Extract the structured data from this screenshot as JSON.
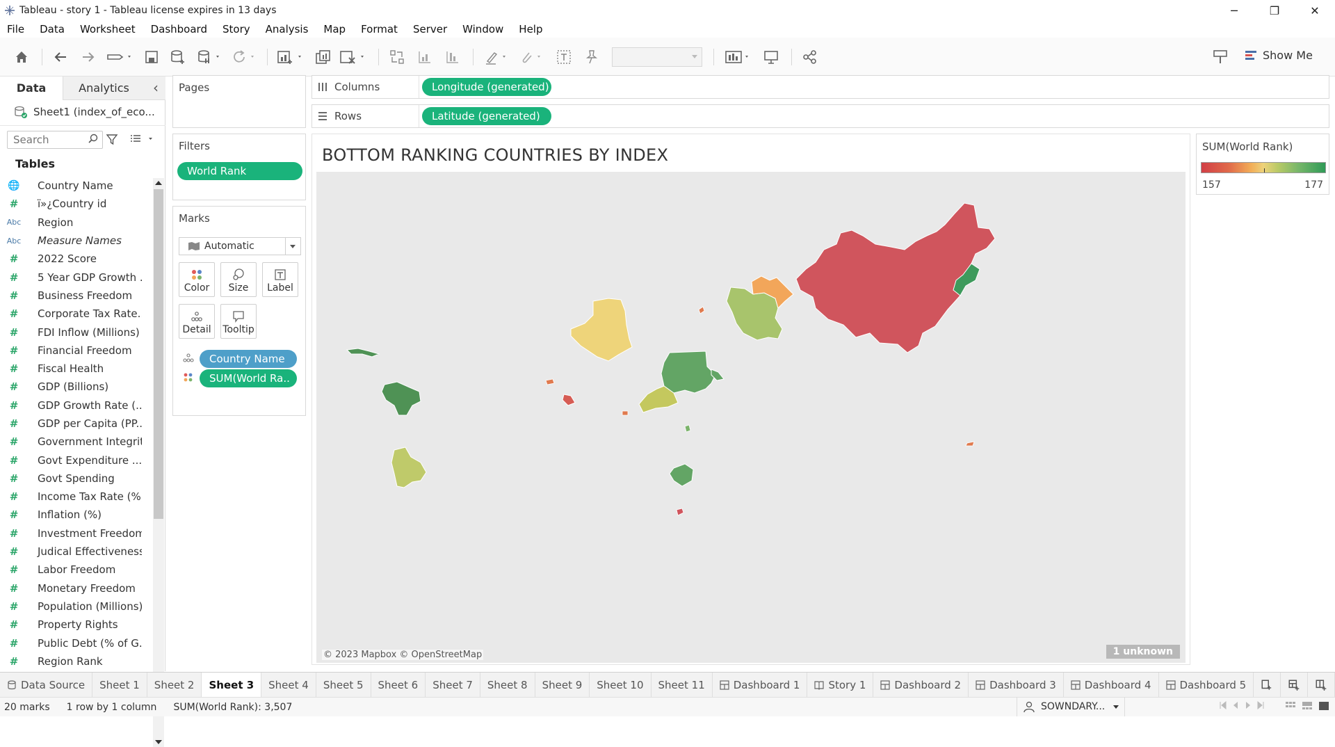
{
  "window": {
    "title": "Tableau - story 1 - Tableau license expires in 13 days",
    "minimize": "─",
    "restore": "❐",
    "close": "✕"
  },
  "menu": [
    "File",
    "Data",
    "Worksheet",
    "Dashboard",
    "Story",
    "Analysis",
    "Map",
    "Format",
    "Server",
    "Window",
    "Help"
  ],
  "toolbar": {
    "show_me": "Show Me"
  },
  "left_panel": {
    "tab_data": "Data",
    "tab_analytics": "Analytics",
    "collapse": "‹",
    "data_source": "Sheet1 (index_of_eco...",
    "search_placeholder": "Search",
    "tables_heading": "Tables",
    "fields": [
      {
        "type": "geo",
        "name": "Country Name",
        "italic": false
      },
      {
        "type": "num",
        "name": "ï»¿Country id",
        "italic": false
      },
      {
        "type": "abc",
        "name": "Region",
        "italic": false
      },
      {
        "type": "abc",
        "name": "Measure Names",
        "italic": true
      },
      {
        "type": "num",
        "name": "2022 Score",
        "italic": false
      },
      {
        "type": "num",
        "name": "5 Year GDP Growth ...",
        "italic": false
      },
      {
        "type": "num",
        "name": "Business Freedom",
        "italic": false
      },
      {
        "type": "num",
        "name": "Corporate Tax Rate...",
        "italic": false
      },
      {
        "type": "num",
        "name": "FDI Inflow (Millions)",
        "italic": false
      },
      {
        "type": "num",
        "name": "Financial Freedom",
        "italic": false
      },
      {
        "type": "num",
        "name": "Fiscal Health",
        "italic": false
      },
      {
        "type": "num",
        "name": "GDP (Billions)",
        "italic": false
      },
      {
        "type": "num",
        "name": "GDP Growth Rate (...",
        "italic": false
      },
      {
        "type": "num",
        "name": "GDP per Capita (PP...",
        "italic": false
      },
      {
        "type": "num",
        "name": "Government Integrity",
        "italic": false
      },
      {
        "type": "num",
        "name": "Govt Expenditure ...",
        "italic": false
      },
      {
        "type": "num",
        "name": "Govt Spending",
        "italic": false
      },
      {
        "type": "num",
        "name": "Income Tax Rate (%)",
        "italic": false
      },
      {
        "type": "num",
        "name": "Inflation (%)",
        "italic": false
      },
      {
        "type": "num",
        "name": "Investment Freedom",
        "italic": false
      },
      {
        "type": "num",
        "name": "Judical Effectiveness",
        "italic": false
      },
      {
        "type": "num",
        "name": "Labor Freedom",
        "italic": false
      },
      {
        "type": "num",
        "name": "Monetary Freedom",
        "italic": false
      },
      {
        "type": "num",
        "name": "Population (Millions)",
        "italic": false
      },
      {
        "type": "num",
        "name": "Property Rights",
        "italic": false
      },
      {
        "type": "num",
        "name": "Public Debt (% of G...",
        "italic": false
      },
      {
        "type": "num",
        "name": "Region Rank",
        "italic": false
      }
    ]
  },
  "cards": {
    "pages": "Pages",
    "filters": "Filters",
    "filter_pill": "World Rank",
    "marks": "Marks",
    "mark_type": "Automatic",
    "mark_buttons": {
      "color": "Color",
      "size": "Size",
      "label": "Label",
      "detail": "Detail",
      "tooltip": "Tooltip"
    },
    "mark_pill_detail": "Country Name",
    "mark_pill_color": "SUM(World Ra.."
  },
  "shelves": {
    "columns_label": "Columns",
    "columns_pill": "Longitude (generated)",
    "rows_label": "Rows",
    "rows_pill": "Latitude (generated)"
  },
  "viz": {
    "title": "BOTTOM RANKING COUNTRIES BY INDEX",
    "attribution": "© 2023 Mapbox © OpenStreetMap",
    "unknown_badge": "1 unknown"
  },
  "legend": {
    "title": "SUM(World Rank)",
    "min": "157",
    "max": "177",
    "colors": [
      "#d13f46",
      "#f2ad58",
      "#edd27a",
      "#2f9a57"
    ]
  },
  "sheet_tabs": [
    {
      "label": "Data Source",
      "icon": "database-icon",
      "active": false
    },
    {
      "label": "Sheet 1",
      "icon": "",
      "active": false
    },
    {
      "label": "Sheet 2",
      "icon": "",
      "active": false
    },
    {
      "label": "Sheet 3",
      "icon": "",
      "active": true
    },
    {
      "label": "Sheet 4",
      "icon": "",
      "active": false
    },
    {
      "label": "Sheet 5",
      "icon": "",
      "active": false
    },
    {
      "label": "Sheet 6",
      "icon": "",
      "active": false
    },
    {
      "label": "Sheet 7",
      "icon": "",
      "active": false
    },
    {
      "label": "Sheet 8",
      "icon": "",
      "active": false
    },
    {
      "label": "Sheet 9",
      "icon": "",
      "active": false
    },
    {
      "label": "Sheet 10",
      "icon": "",
      "active": false
    },
    {
      "label": "Sheet 11",
      "icon": "",
      "active": false
    },
    {
      "label": "Dashboard 1",
      "icon": "dashboard-icon",
      "active": false
    },
    {
      "label": "Story 1",
      "icon": "story-icon",
      "active": false
    },
    {
      "label": "Dashboard 2",
      "icon": "dashboard-icon",
      "active": false
    },
    {
      "label": "Dashboard 3",
      "icon": "dashboard-icon",
      "active": false
    },
    {
      "label": "Dashboard 4",
      "icon": "dashboard-icon",
      "active": false
    },
    {
      "label": "Dashboard 5",
      "icon": "dashboard-icon",
      "active": false
    }
  ],
  "status": {
    "marks": "20 marks",
    "layout": "1 row by 1 column",
    "sum": "SUM(World Rank): 3,507",
    "user": "SOWNDARY..."
  }
}
